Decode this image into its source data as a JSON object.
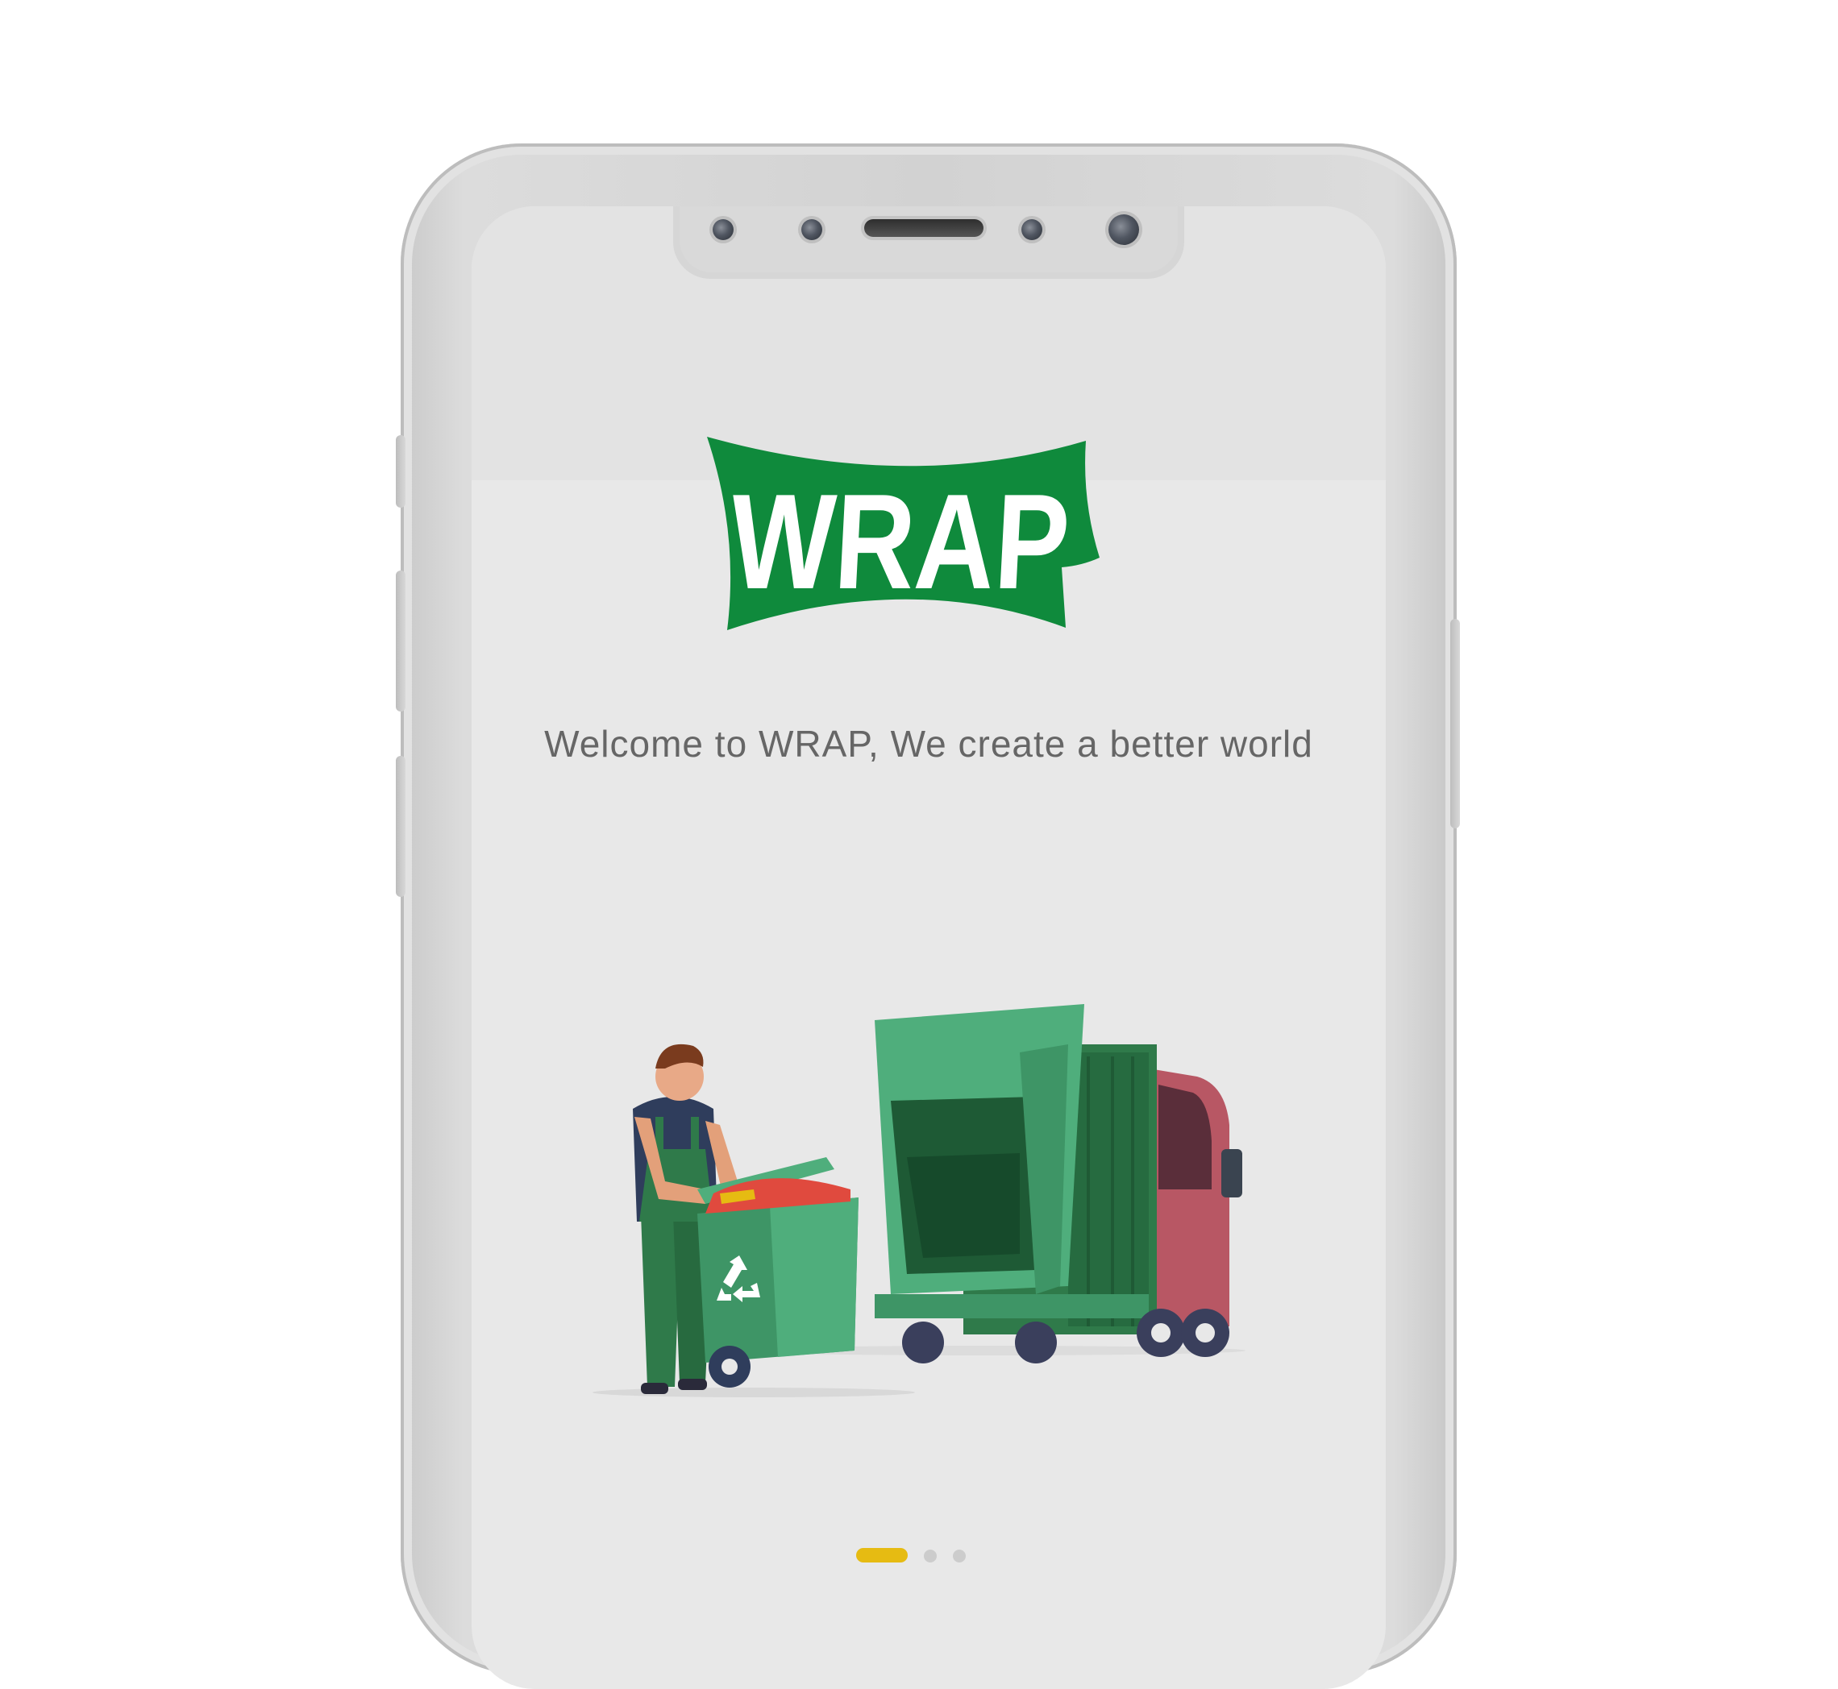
{
  "brand": {
    "logo_text": "WRAP",
    "primary_color": "#0f8a3c",
    "accent_color": "#e6bb12"
  },
  "onboarding": {
    "welcome_text": "Welcome to WRAP, We create a better world",
    "illustration_icon": "recycling-worker-with-bin-and-garbage-truck",
    "page_indicator": {
      "total": 3,
      "current": 1
    }
  }
}
